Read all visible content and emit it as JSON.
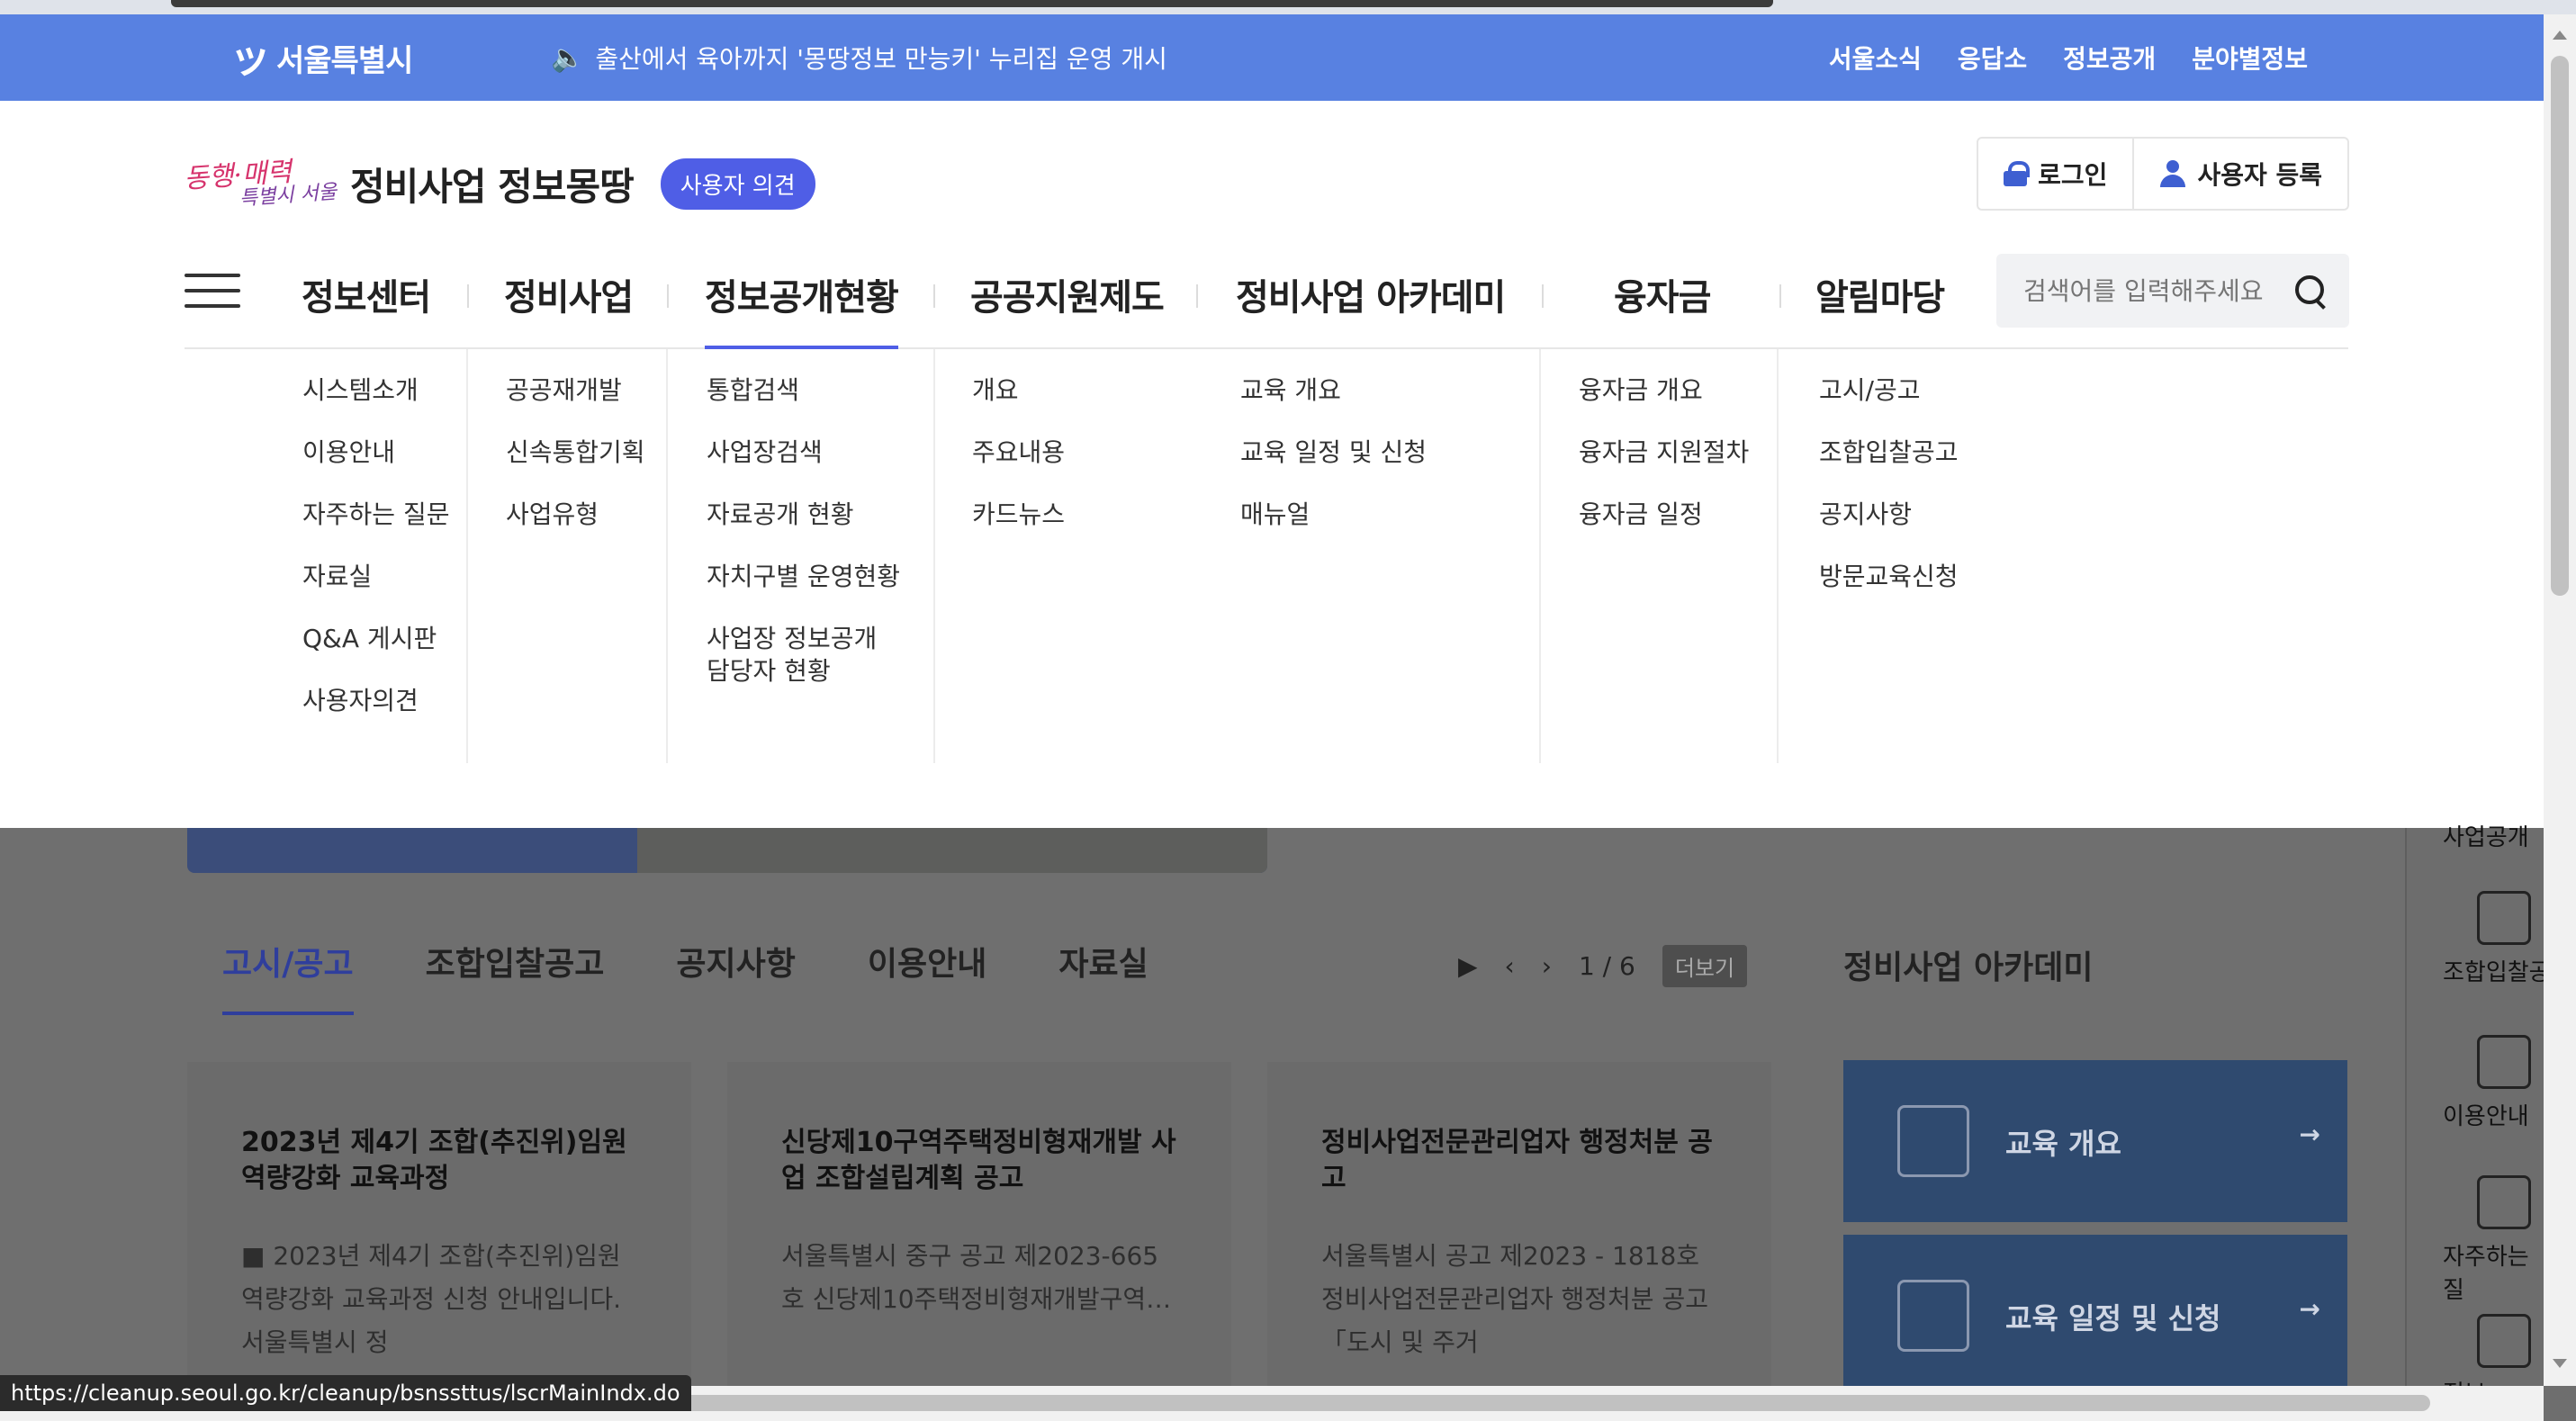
{
  "util_bar": {
    "logo_text": "서울특별시",
    "notice": "출산에서 육아까지 '몽땅정보 만능키' 누리집 운영 개시",
    "links": [
      "서울소식",
      "응답소",
      "정보공개",
      "분야별정보"
    ]
  },
  "header": {
    "slogan_top": "동행·매력",
    "slogan_bottom": "특별시 서울",
    "site_title": "정비사업 정보몽땅",
    "opinion_button": "사용자 의견",
    "login": "로그인",
    "register": "사용자 등록"
  },
  "gnb": {
    "items": [
      "정보센터",
      "정비사업",
      "정보공개현황",
      "공공지원제도",
      "정비사업 아카데미",
      "융자금",
      "알림마당"
    ],
    "active_index": 2,
    "search_placeholder": "검색어를 입력해주세요"
  },
  "mega_menu": {
    "columns": [
      [
        "시스템소개",
        "이용안내",
        "자주하는 질문",
        "자료실",
        "Q&A 게시판",
        "사용자의견"
      ],
      [
        "공공재개발",
        "신속통합기획",
        "사업유형"
      ],
      [
        "통합검색",
        "사업장검색",
        "자료공개 현황",
        "자치구별 운영현황",
        "사업장 정보공개",
        "담당자 현황"
      ],
      [
        "개요",
        "주요내용",
        "카드뉴스"
      ],
      [
        "교육 개요",
        "교육 일정 및 신청",
        "매뉴얼"
      ],
      [
        "융자금 개요",
        "융자금 지원절차",
        "융자금 일정"
      ],
      [
        "고시/공고",
        "조합입찰공고",
        "공지사항",
        "방문교육신청"
      ]
    ],
    "highlighted": "사업장검색"
  },
  "board": {
    "tabs": [
      "고시/공고",
      "조합입찰공고",
      "공지사항",
      "이용안내",
      "자료실"
    ],
    "active_tab": 0,
    "page": "1 / 6",
    "more": "더보기",
    "cards": [
      {
        "title": "2023년 제4기 조합(추진위)임원 역량강화 교육과정",
        "body": "■ 2023년 제4기 조합(추진위)임원 역량강화 교육과정 신청 안내입니다. 서울특별시 정"
      },
      {
        "title": "신당제10구역주택정비형재개발 사업 조합설립계획 공고",
        "body": "서울특별시 중구 공고 제2023-665호 신당제10주택정비형재개발구역…"
      },
      {
        "title": "정비사업전문관리업자 행정처분 공고",
        "body": "서울특별시 공고 제2023 - 1818호 정비사업전문관리업자 행정처분 공고「도시 및 주거"
      }
    ]
  },
  "academy": {
    "title": "정비사업 아카데미",
    "items": [
      "교육 개요",
      "교육 일정 및 신청"
    ]
  },
  "quick_menu": [
    "사업공개",
    "조합입찰공",
    "이용안내",
    "자주하는 질",
    "정보"
  ],
  "status_url": "https://cleanup.seoul.go.kr/cleanup/bsnssttus/lscrMainIndx.do"
}
